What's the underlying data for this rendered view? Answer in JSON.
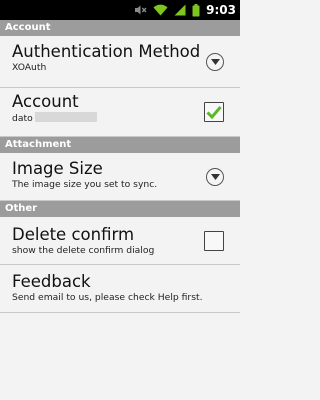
{
  "status_bar": {
    "time": "9:03",
    "icons": [
      "mute-icon",
      "wifi-icon",
      "signal-icon",
      "battery-icon"
    ]
  },
  "sections": {
    "account": "Account",
    "attachment": "Attachment",
    "other": "Other"
  },
  "prefs": {
    "auth_method": {
      "title": "Authentication Method",
      "summary": "XOAuth"
    },
    "account": {
      "title": "Account",
      "summary": "dato",
      "checked": true
    },
    "image_size": {
      "title": "Image Size",
      "summary": "The image size you set to sync."
    },
    "delete_confirm": {
      "title": "Delete confirm",
      "summary": "show the delete confirm dialog",
      "checked": false
    },
    "feedback": {
      "title": "Feedback",
      "summary": "Send email to us, please check Help first."
    }
  },
  "colors": {
    "status_bar_bg": "#000000",
    "section_header_bg": "#9c9c9c",
    "list_bg": "#f3f3f3",
    "checkmark": "#5ab82a"
  }
}
